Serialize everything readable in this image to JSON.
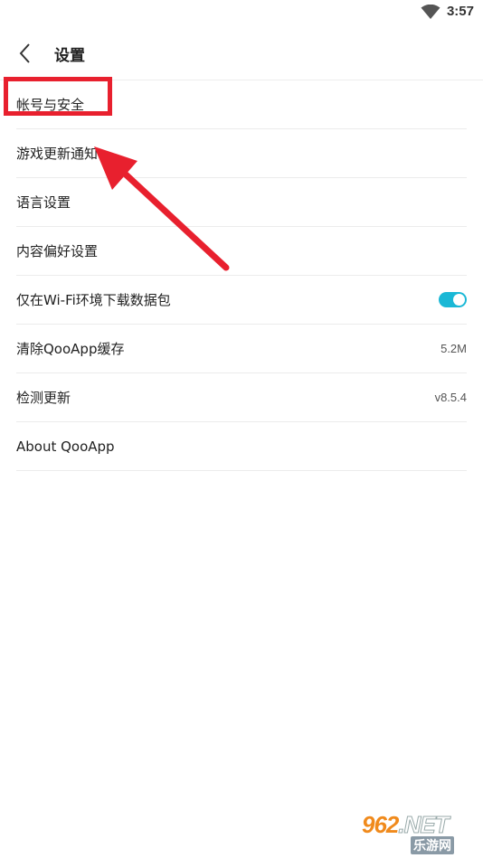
{
  "status_bar": {
    "time": "3:57",
    "wifi_icon": "wifi-icon"
  },
  "header": {
    "title": "设置",
    "back_icon": "chevron-left-icon"
  },
  "settings": [
    {
      "label": "帐号与安全"
    },
    {
      "label": "游戏更新通知"
    },
    {
      "label": "语言设置"
    },
    {
      "label": "内容偏好设置"
    },
    {
      "label": "仅在Wi-Fi环境下载数据包",
      "toggle_on": true
    },
    {
      "label": "清除QooApp缓存",
      "value": "5.2M"
    },
    {
      "label": "检测更新",
      "value": "v8.5.4"
    },
    {
      "label": "About QooApp"
    }
  ],
  "colors": {
    "accent": "#1ab8d6",
    "annotation": "#e8202e",
    "watermark": "#f08a1c"
  },
  "watermark": {
    "brand": "962",
    "suffix": ".NET",
    "subtitle": "乐游网"
  }
}
